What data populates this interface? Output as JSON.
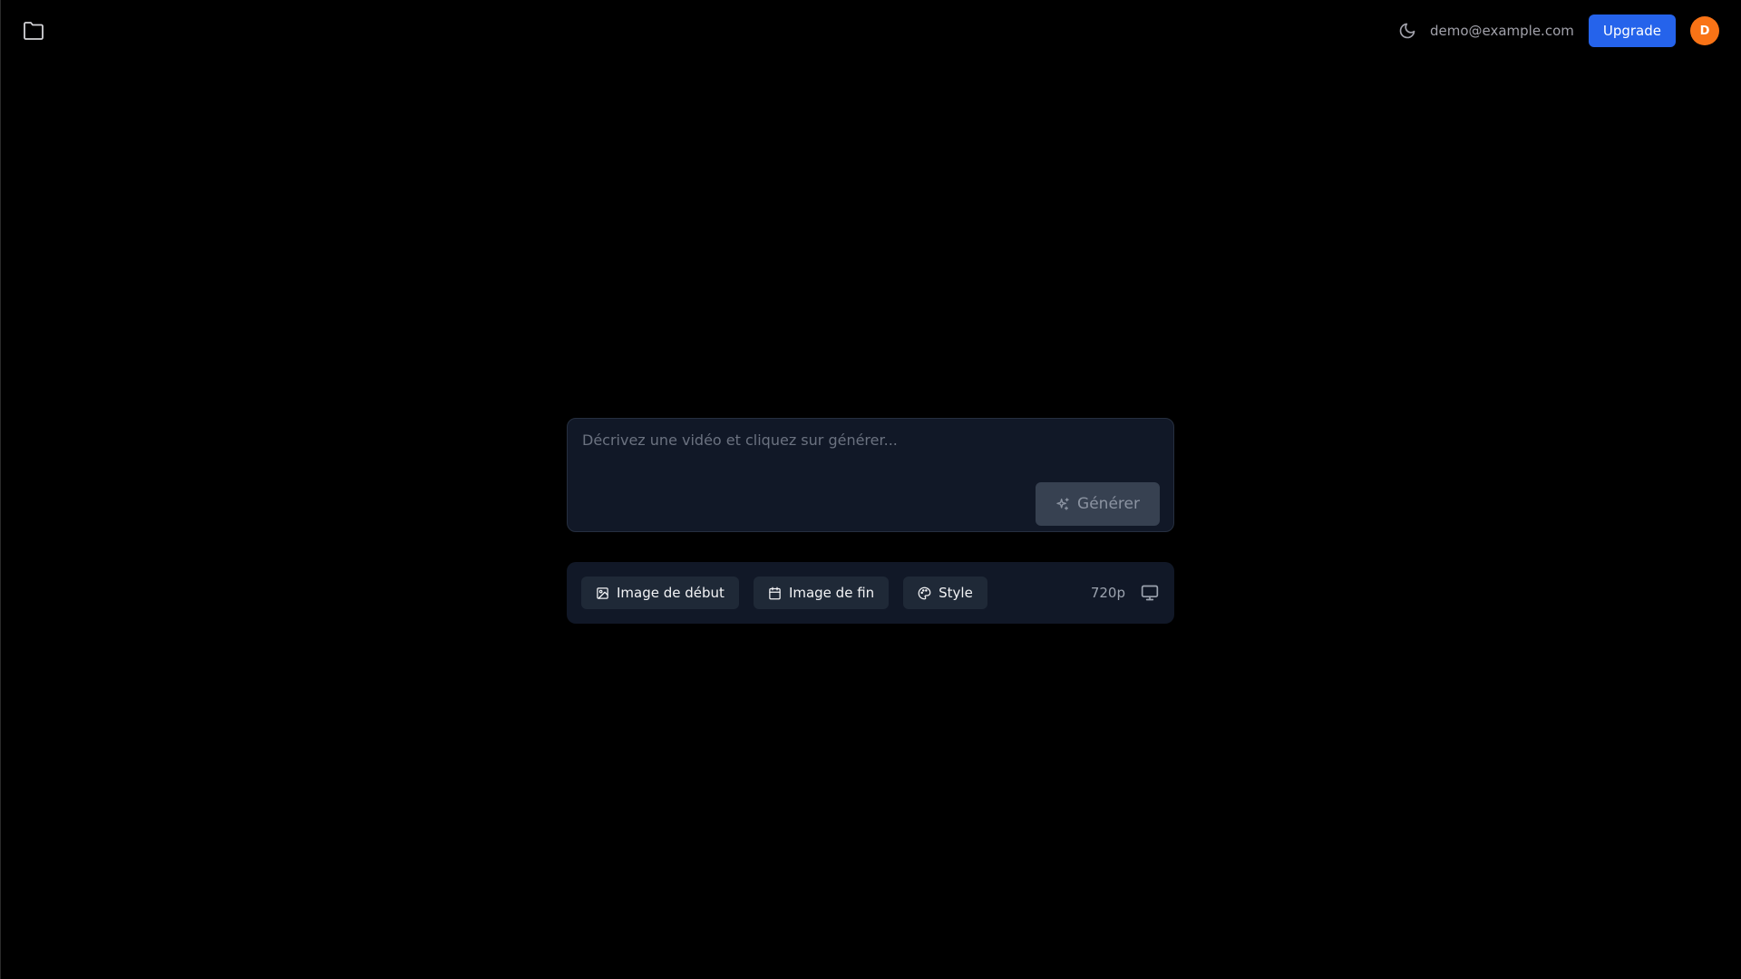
{
  "header": {
    "folder_icon": "folder-icon",
    "theme_icon": "moon-icon",
    "user_email": "demo@example.com",
    "upgrade_label": "Upgrade",
    "avatar_initial": "D"
  },
  "prompt": {
    "placeholder": "Décrivez une vidéo et cliquez sur générer...",
    "value": "",
    "generate_label": "Générer",
    "generate_icon": "sparkles-icon"
  },
  "options": {
    "start_image_label": "Image de début",
    "start_image_icon": "image-icon",
    "end_image_label": "Image de fin",
    "end_image_icon": "calendar-icon",
    "style_label": "Style",
    "style_icon": "palette-icon",
    "resolution": "720p",
    "display_icon": "monitor-icon"
  },
  "colors": {
    "background": "#000000",
    "panel": "#111827",
    "button": "#1f2937",
    "accent": "#2563eb",
    "avatar": "#f97316"
  }
}
